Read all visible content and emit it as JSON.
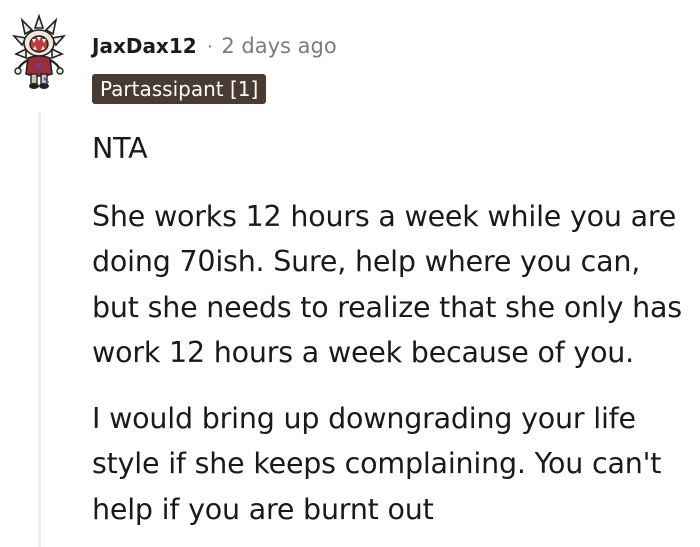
{
  "comment": {
    "avatar_icon": "snoo-demogorgon-avatar-icon",
    "username": "JaxDax12",
    "separator": "·",
    "timestamp": "2 days ago",
    "flair": "Partassipant [1]",
    "flair_color": "#4a3b32",
    "thread_line_color": "#ededed",
    "paragraphs": [
      "NTA",
      "She works 12 hours a week while you are doing 70ish. Sure, help where you can, but she needs to realize that she only has work 12 hours a week because of you.",
      "I would bring up downgrading your life style if she keeps complaining. You can't help if you are burnt out"
    ]
  }
}
